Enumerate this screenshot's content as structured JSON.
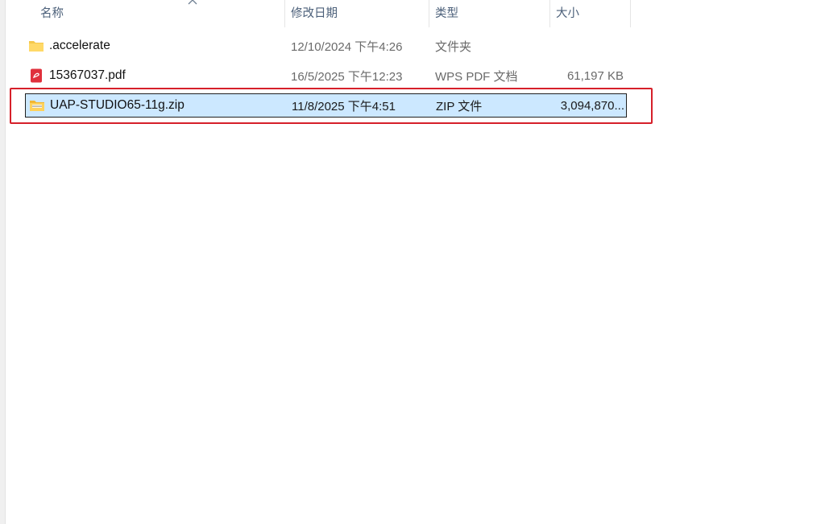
{
  "columns": {
    "name": "名称",
    "modified": "修改日期",
    "type": "类型",
    "size": "大小"
  },
  "files": [
    {
      "name": ".accelerate",
      "modified": "12/10/2024 下午4:26",
      "type": "文件夹",
      "size": "",
      "icon": "folder-icon",
      "selected": false
    },
    {
      "name": "15367037.pdf",
      "modified": "16/5/2025 下午12:23",
      "type": "WPS PDF 文档",
      "size": "61,197 KB",
      "icon": "pdf-icon",
      "selected": false
    },
    {
      "name": "UAP-STUDIO65-11g.zip",
      "modified": "11/8/2025 下午4:51",
      "type": "ZIP 文件",
      "size": "3,094,870...",
      "icon": "zip-folder-icon",
      "selected": true
    }
  ],
  "colors": {
    "selection_bg": "#cce8ff",
    "highlight_border": "#d6202a",
    "header_text": "#4c607a",
    "secondary_text": "#6a6a6a"
  }
}
